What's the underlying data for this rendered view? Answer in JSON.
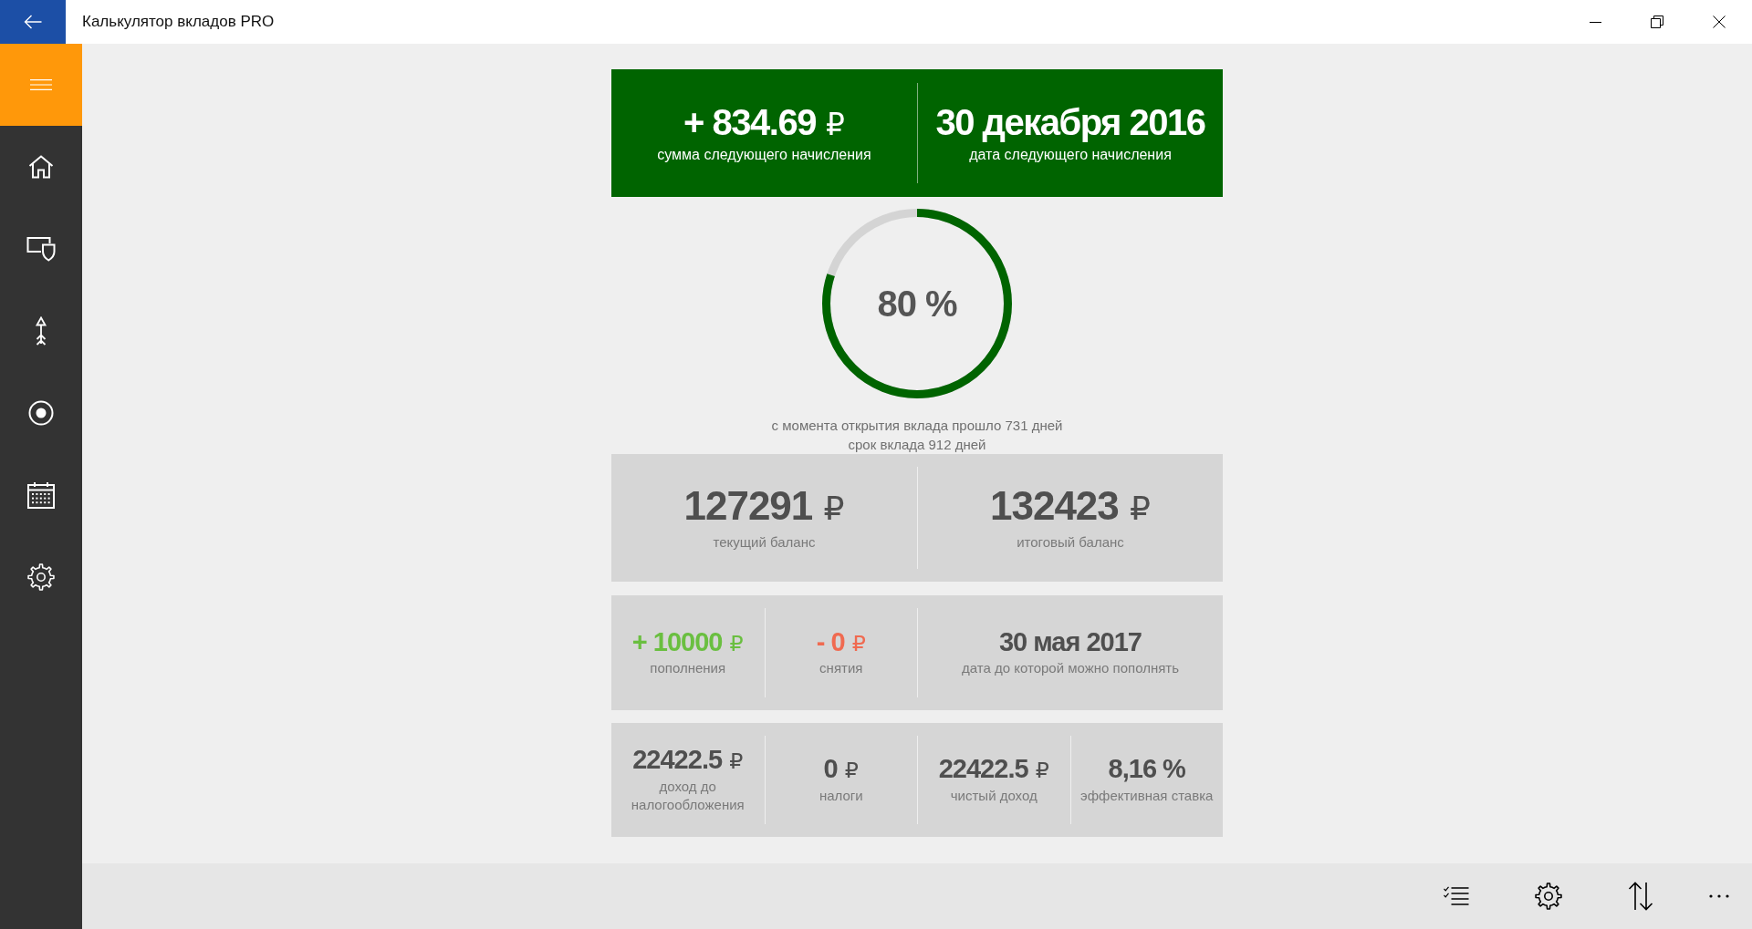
{
  "window": {
    "title": "Калькулятор вкладов PRO"
  },
  "next_accrual": [
    {
      "value": "+ 834.69",
      "unit": "₽",
      "label": "сумма следующего начисления"
    },
    {
      "value": "30 декабря 2016",
      "label": "дата следующего начисления"
    }
  ],
  "progress": {
    "level": 0.8,
    "label": "80 %",
    "elapsed": "с момента открытия вклада прошло 731 дней",
    "term": "срок вклада 912 дней"
  },
  "balances": [
    {
      "value": "127291",
      "unit": "₽",
      "label": "текущий баланс"
    },
    {
      "value": "132423",
      "unit": "₽",
      "label": "итоговый баланс"
    }
  ],
  "operations": [
    {
      "kind": "deposit",
      "value": "+ 10000",
      "unit": "₽",
      "label": "пополнения"
    },
    {
      "kind": "withdrawal",
      "value": "- 0",
      "unit": "₽",
      "label": "снятия"
    },
    {
      "kind": "date",
      "value": "30 мая 2017",
      "label": "дата до которой можно пополнять"
    }
  ],
  "income": [
    {
      "value": "22422.5",
      "unit": "₽",
      "label": "доход до налогообложения"
    },
    {
      "value": "0",
      "unit": "₽",
      "label": "налоги"
    },
    {
      "value": "22422.5",
      "unit": "₽",
      "label": "чистый доход"
    },
    {
      "value": "8,16 %",
      "label": "эффективная ставка"
    }
  ]
}
